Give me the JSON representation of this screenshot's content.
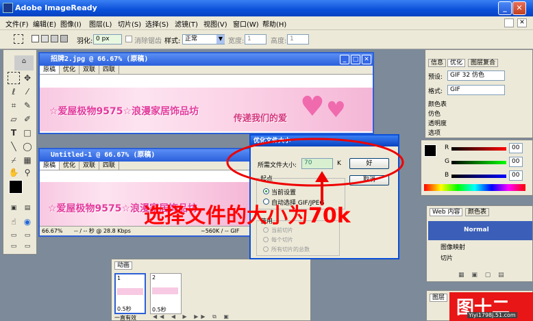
{
  "app": {
    "title": "Adobe ImageReady"
  },
  "menu": [
    "文件(F)",
    "编辑(E)",
    "图像(I)",
    "图层(L)",
    "切片(S)",
    "选择(S)",
    "滤镜(T)",
    "视图(V)",
    "窗口(W)",
    "帮助(H)"
  ],
  "options": {
    "feather_label": "羽化:",
    "feather_value": "0 px",
    "antialias_label": "消除锯齿",
    "style_label": "样式:",
    "style_value": "正常",
    "width_label": "宽度:",
    "width_value": "1",
    "height_label": "高度:",
    "height_value": "1"
  },
  "doc1": {
    "title": "招牌2.jpg @ 66.67% (原稿)",
    "tabs": [
      "原稿",
      "优化",
      "双联",
      "四联"
    ]
  },
  "doc2": {
    "title": "Untitled-1 @ 66.67% (原稿)",
    "tabs": [
      "原稿",
      "优化",
      "双联",
      "四联"
    ],
    "status_zoom": "66.67%",
    "status_a": "-- / -- 秒 @ 28.8 Kbps",
    "status_b": "~560K / -- GIF"
  },
  "banner": {
    "text1": "☆爱屋极物9575☆浪漫家居饰品坊",
    "text2": "传递我们的爱"
  },
  "dialog": {
    "title": "优化文件大小",
    "size_label": "所需文件大小:",
    "size_value": "70",
    "size_unit": "K",
    "ok": "好",
    "cancel": "取消",
    "start_group": "起点",
    "radio_current": "当前设置",
    "radio_auto": "自动选择 GIF/JPEG",
    "use_group": "使用",
    "use_current": "当前切片",
    "use_each": "每个切片",
    "use_total": "所有切片的总数"
  },
  "animation": {
    "tab": "动画",
    "frame1_num": "1",
    "frame1_delay": "0.5秒",
    "frame2_num": "2",
    "frame2_delay": "0.5秒",
    "loop": "一直有效"
  },
  "optimize_panel": {
    "tabs": [
      "信息",
      "优化",
      "图层复合"
    ],
    "preset_label": "预设:",
    "preset_value": "GIF 32 仿色",
    "format_label": "格式:",
    "format_value": "GIF",
    "sections": [
      "颜色表",
      "仿色",
      "透明度",
      "选项"
    ]
  },
  "color_panel": {
    "r_label": "R",
    "g_label": "G",
    "b_label": "B",
    "r_val": "00",
    "g_val": "00",
    "b_val": "00"
  },
  "web_panel": {
    "tabs": [
      "Web 内容",
      "颜色表"
    ],
    "normal": "Normal",
    "items": [
      "图像映射",
      "切片"
    ]
  },
  "layers_panel": {
    "tab": "图层"
  },
  "annotation": {
    "text": "选择文件的大小为70k",
    "figure_label": "图十二",
    "watermark": "Yiyi1798j.51.com"
  }
}
